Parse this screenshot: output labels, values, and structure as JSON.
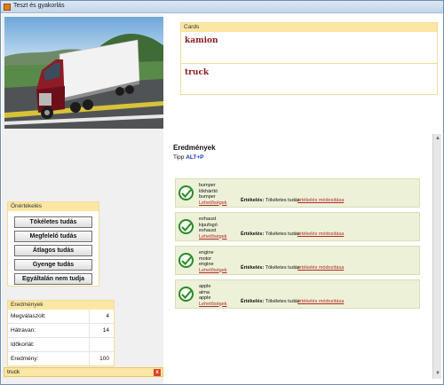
{
  "window": {
    "title": "Teszt és gyakorlás"
  },
  "cards": {
    "title": "Cards",
    "items": [
      "kamion",
      "truck"
    ]
  },
  "evaluation": {
    "title": "Önértékelés",
    "buttons": [
      "Tökéletes tudás",
      "Megfelelő tudás",
      "Átlagos tudás",
      "Gyenge tudás",
      "Egyáltalán nem tudja"
    ]
  },
  "results": {
    "title": "Eredmények",
    "rows": [
      {
        "label": "Megválaszolt:",
        "value": "4"
      },
      {
        "label": "Hátravan:",
        "value": "14"
      },
      {
        "label": "Időkorlát:",
        "value": ""
      },
      {
        "label": "Eredmény:",
        "value": "100"
      }
    ]
  },
  "status": {
    "text": "truck",
    "close_label": "x"
  },
  "right_results": {
    "title": "Eredmények",
    "hint_prefix": "Tipp",
    "hint_key": "ALT+P",
    "item_link": "Lehetőségek",
    "ert_label": "Értékelés:",
    "ert_value": "Tökéletes tudás",
    "mod_link": "értékelés módosítása",
    "items": [
      {
        "lines": [
          "bumper",
          "lökhárító",
          "bumper"
        ]
      },
      {
        "lines": [
          "exhaust",
          "kipufogó",
          "exhaust"
        ]
      },
      {
        "lines": [
          "engine",
          "motor",
          "engine"
        ]
      },
      {
        "lines": [
          "apple",
          "alma",
          "apple"
        ]
      }
    ]
  },
  "colors": {
    "accent": "#8b1a1a",
    "panel_header": "#fbe7a3",
    "result_bg": "#edf1d8",
    "check": "#2a8a2a"
  },
  "icons": {
    "check": "check-icon",
    "close": "close-icon"
  }
}
